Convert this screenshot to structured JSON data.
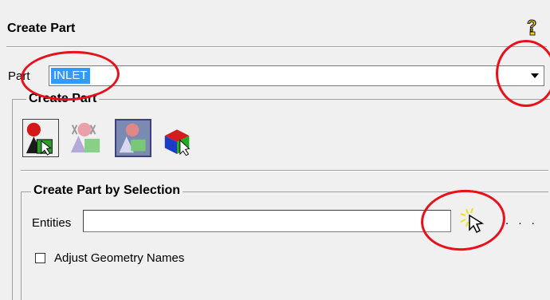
{
  "header": {
    "title": "Create Part"
  },
  "part": {
    "label": "Part",
    "value": "INLET"
  },
  "create_part_group": {
    "legend": "Create Part"
  },
  "tools": [
    {
      "name": "create-part-by-selection-tool"
    },
    {
      "name": "create-part-by-body-tool"
    },
    {
      "name": "create-part-by-geometry-tool"
    },
    {
      "name": "create-part-by-blocks-tool"
    }
  ],
  "selection_group": {
    "legend": "Create Part by Selection",
    "entities_label": "Entities",
    "entities_value": "",
    "more_button": ". . ."
  },
  "options": {
    "adjust_names_label": "Adjust Geometry Names",
    "adjust_names_checked": false
  },
  "colors": {
    "annotation": "#e8101a",
    "selection_highlight": "#3399ff",
    "panel": "#f0f0f0"
  }
}
